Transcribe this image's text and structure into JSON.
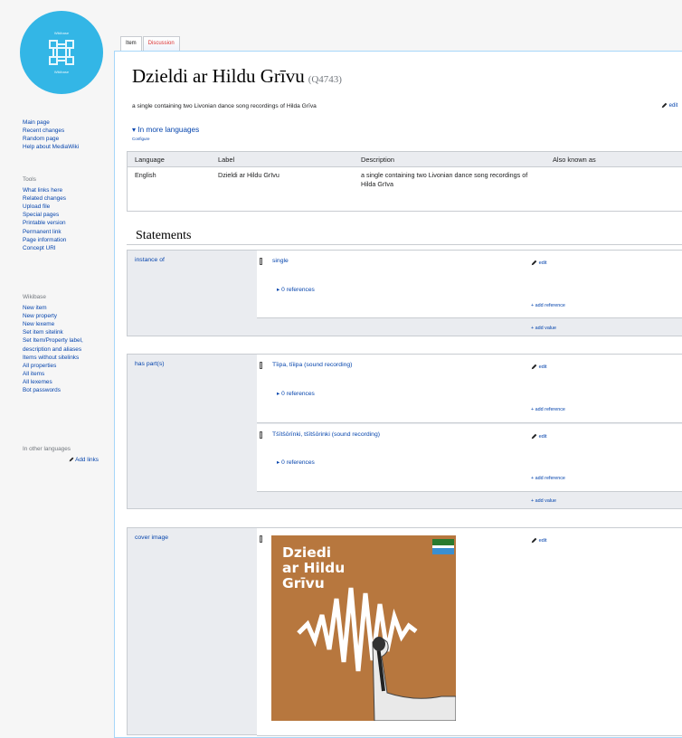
{
  "logo": {
    "top_text": "Wikibase",
    "bottom_text": "Wikibase"
  },
  "sidebar": {
    "main": [
      "Main page",
      "Recent changes",
      "Random page",
      "Help about MediaWiki"
    ],
    "tools_heading": "Tools",
    "tools": [
      "What links here",
      "Related changes",
      "Upload file",
      "Special pages",
      "Printable version",
      "Permanent link",
      "Page information",
      "Concept URI"
    ],
    "wikibase_heading": "Wikibase",
    "wikibase": [
      "New item",
      "New property",
      "New lexeme",
      "Set item sitelink",
      "Set Item/Property label, description and aliases",
      "Items without sitelinks",
      "All properties",
      "All items",
      "All lexemes",
      "Bot passwords"
    ],
    "other_languages_heading": "In other languages",
    "add_links": "Add links"
  },
  "tabs": {
    "item": "Item",
    "discussion": "Discussion"
  },
  "page": {
    "title": "Dzieldi ar Hildu Grīvu",
    "qid": "(Q4743)",
    "description": "a single containing two Livonian dance song recordings of Hilda Grīva",
    "description_edit": "edit",
    "more_languages": "In more languages",
    "configure": "Configure"
  },
  "lang_table": {
    "headers": [
      "Language",
      "Label",
      "Description",
      "Also known as"
    ],
    "rows": [
      {
        "language": "English",
        "label": "Dzieldi ar Hildu Grīvu",
        "description": "a single containing two Livonian dance song recordings of Hilda Grīva",
        "aliases": ""
      }
    ]
  },
  "statements": {
    "heading": "Statements",
    "instance_of": {
      "property": "instance of",
      "value": "single",
      "refs": "0 references",
      "edit": "edit",
      "add_reference": "add reference",
      "add_value": "add value"
    },
    "has_parts": {
      "property": "has part(s)",
      "values": [
        {
          "value": "Tīipa, tīiipa (sound recording)",
          "refs": "0 references",
          "edit": "edit",
          "add_reference": "add reference"
        },
        {
          "value": "Tšītšōrīnki, tšītšōrinki (sound recording)",
          "refs": "0 references",
          "edit": "edit",
          "add_reference": "add reference"
        }
      ],
      "add_value": "add value"
    },
    "cover_image": {
      "property": "cover image",
      "edit": "edit",
      "cover_text": [
        "Dziedi",
        "ar Hildu",
        "Grīvu"
      ]
    }
  },
  "colors": {
    "logo": "#33b6e6",
    "link": "#0645ad",
    "cover": "#b7773e"
  }
}
